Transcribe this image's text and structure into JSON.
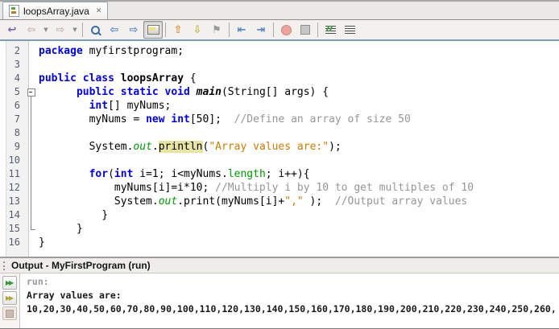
{
  "tab": {
    "label": "loopsArray.java",
    "close_glyph": "✕"
  },
  "toolbar": {
    "items": [
      "jump-last-edit",
      "back",
      "back-dropdown",
      "forward",
      "forward-dropdown",
      "separator",
      "find-selection",
      "prev-occurrence",
      "next-occurrence",
      "toggle-highlight",
      "separator",
      "prev-bookmark",
      "next-bookmark",
      "toggle-bookmark",
      "separator",
      "shift-left",
      "shift-right",
      "separator",
      "macro-record",
      "macro-stop",
      "separator",
      "comment",
      "uncomment"
    ]
  },
  "colors": {
    "keyword": "#0000e6",
    "string": "#ce7b00",
    "comment": "#969696",
    "field": "#009900",
    "occurrence_highlight": "#e6e5a1",
    "toolbar_underline": "#7d9cbc"
  },
  "editor": {
    "lines": [
      {
        "n": 2,
        "indent": 0,
        "fold": "",
        "segs": [
          [
            "kw",
            "package"
          ],
          [
            "pl",
            " myfirstprogram;"
          ]
        ]
      },
      {
        "n": 3,
        "indent": 0,
        "fold": "",
        "segs": []
      },
      {
        "n": 4,
        "indent": 0,
        "fold": "",
        "segs": [
          [
            "kw",
            "public class"
          ],
          [
            "cls",
            " loopsArray"
          ],
          [
            "pl",
            " {"
          ]
        ]
      },
      {
        "n": 5,
        "indent": 6,
        "fold": "start",
        "segs": [
          [
            "kw",
            "public static void"
          ],
          [
            "mth",
            " main"
          ],
          [
            "pl",
            "(String[] args) {"
          ]
        ]
      },
      {
        "n": 6,
        "indent": 8,
        "fold": "mid",
        "segs": [
          [
            "kw",
            "int"
          ],
          [
            "pl",
            "[] myNums;"
          ]
        ]
      },
      {
        "n": 7,
        "indent": 8,
        "fold": "mid",
        "segs": [
          [
            "pl",
            "myNums = "
          ],
          [
            "kw",
            "new"
          ],
          [
            "pl",
            " "
          ],
          [
            "kw",
            "int"
          ],
          [
            "pl",
            "[50];  "
          ],
          [
            "cm",
            "//Define an array of size 50"
          ]
        ]
      },
      {
        "n": 8,
        "indent": 0,
        "fold": "mid",
        "segs": []
      },
      {
        "n": 9,
        "indent": 8,
        "fold": "mid",
        "segs": [
          [
            "pl",
            "System."
          ],
          [
            "fldi",
            "out"
          ],
          [
            "pl",
            "."
          ],
          [
            "mark",
            "println"
          ],
          [
            "pl",
            "("
          ],
          [
            "str",
            "\"Array values are:\""
          ],
          [
            "pl",
            ");"
          ]
        ]
      },
      {
        "n": 10,
        "indent": 0,
        "fold": "mid",
        "segs": []
      },
      {
        "n": 11,
        "indent": 8,
        "fold": "mid",
        "segs": [
          [
            "kw",
            "for"
          ],
          [
            "pl",
            "("
          ],
          [
            "kw",
            "int"
          ],
          [
            "pl",
            " i=1; i<myNums."
          ],
          [
            "fld",
            "length"
          ],
          [
            "pl",
            "; i++){"
          ]
        ]
      },
      {
        "n": 12,
        "indent": 12,
        "fold": "mid",
        "segs": [
          [
            "pl",
            "myNums[i]=i*10; "
          ],
          [
            "cm",
            "//Multiply i by 10 to get multiples of 10"
          ]
        ]
      },
      {
        "n": 13,
        "indent": 12,
        "fold": "mid",
        "segs": [
          [
            "pl",
            "System."
          ],
          [
            "fldi",
            "out"
          ],
          [
            "pl",
            ".print(myNums[i]+"
          ],
          [
            "str",
            "\",\""
          ],
          [
            "pl",
            " );  "
          ],
          [
            "cm",
            "//Output array values"
          ]
        ]
      },
      {
        "n": 14,
        "indent": 10,
        "fold": "mid",
        "segs": [
          [
            "pl",
            "}"
          ]
        ]
      },
      {
        "n": 15,
        "indent": 6,
        "fold": "end",
        "segs": [
          [
            "pl",
            "}"
          ]
        ]
      },
      {
        "n": 16,
        "indent": 0,
        "fold": "",
        "segs": [
          [
            "pl",
            "}"
          ]
        ]
      }
    ]
  },
  "output": {
    "title": "Output - MyFirstProgram (run)",
    "buttons": [
      "rerun",
      "rerun-with-changes",
      "stop"
    ],
    "lines": [
      {
        "style": "muted",
        "text": "run:"
      },
      {
        "style": "normal",
        "text": "Array values are:"
      },
      {
        "style": "normal",
        "text": "10,20,30,40,50,60,70,80,90,100,110,120,130,140,150,160,170,180,190,200,210,220,230,240,250,260,"
      }
    ]
  }
}
